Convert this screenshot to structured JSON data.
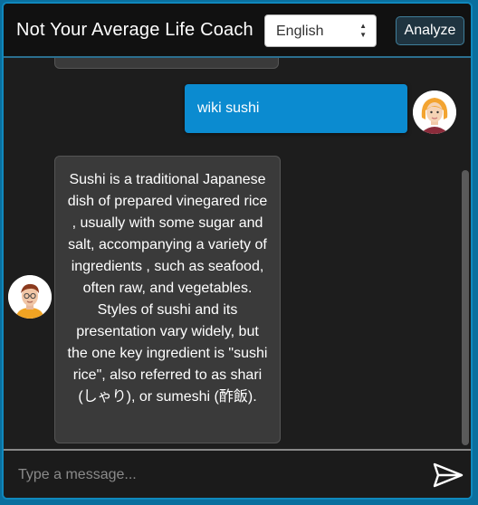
{
  "header": {
    "title": "Not Your Average Life Coach",
    "language_selected": "English",
    "analyze_label": "Analyze"
  },
  "messages": [
    {
      "role": "bot",
      "text": ""
    },
    {
      "role": "user",
      "text": "wiki sushi",
      "avatar": "woman-avatar-icon"
    },
    {
      "role": "bot",
      "text": "Sushi is a traditional Japanese dish of prepared vinegared rice , usually with some sugar and salt, accompanying a variety of ingredients , such as seafood, often raw, and vegetables. Styles of sushi and its presentation vary widely, but the one key ingredient is \"sushi rice\", also referred to as shari (しゃり), or sumeshi (酢飯).",
      "avatar": "man-avatar-icon"
    }
  ],
  "composer": {
    "placeholder": "Type a message...",
    "send_icon": "send-icon"
  },
  "colors": {
    "accent": "#0b8bd0",
    "frame_border": "#0f88bd",
    "background": "#1d1d1d",
    "bot_bubble": "#3a3a3a"
  }
}
